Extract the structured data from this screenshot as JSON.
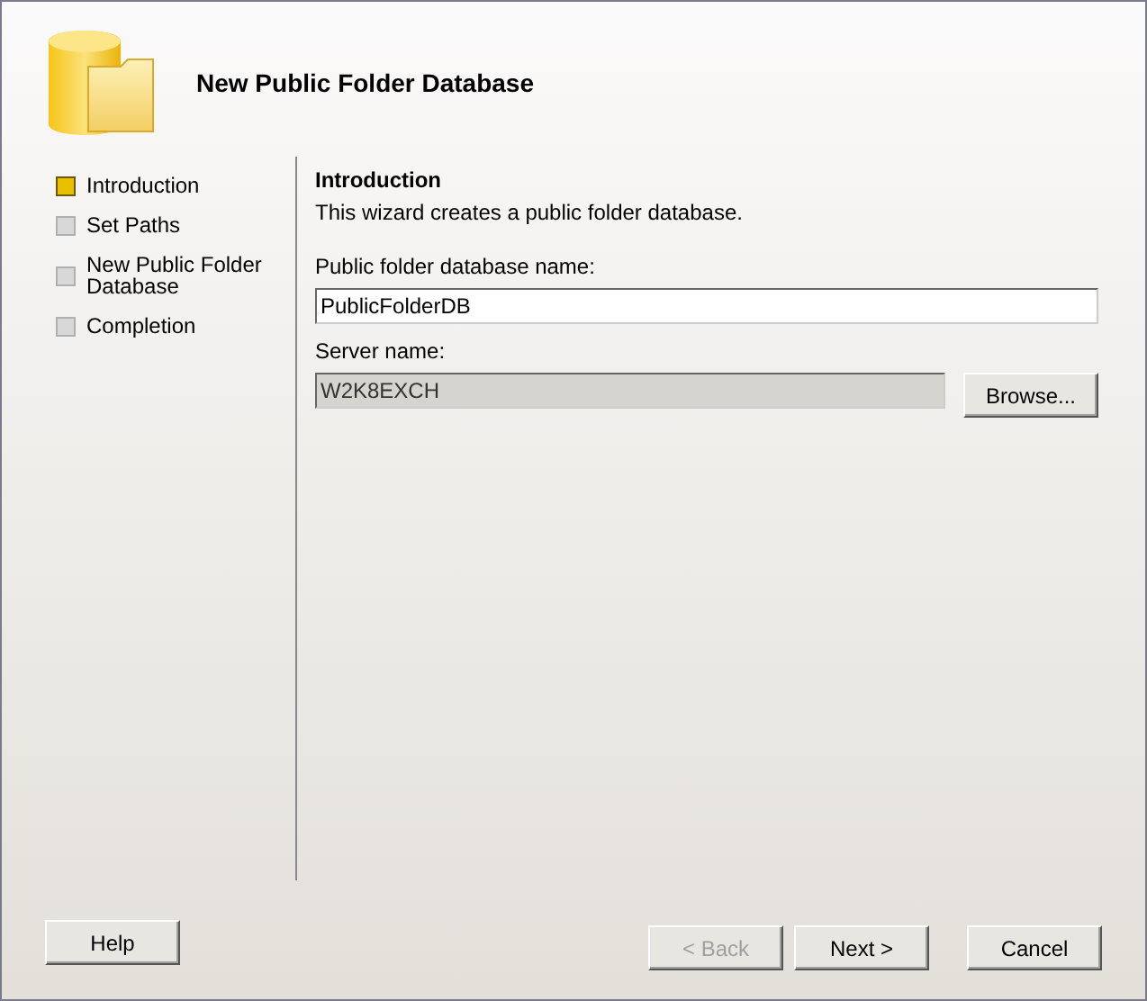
{
  "header": {
    "title": "New Public Folder Database"
  },
  "steps": [
    {
      "label": "Introduction",
      "selected": true
    },
    {
      "label": "Set Paths",
      "selected": false
    },
    {
      "label": "New Public Folder Database",
      "selected": false
    },
    {
      "label": "Completion",
      "selected": false
    }
  ],
  "page": {
    "heading": "Introduction",
    "description": "This wizard creates a public folder database.",
    "fields": [
      {
        "label": "Public folder database name:",
        "value": "PublicFolderDB",
        "disabled": false
      },
      {
        "label": "Server name:",
        "value": "W2K8EXCH",
        "disabled": true,
        "button": "Browse..."
      }
    ]
  },
  "buttons": {
    "help": "Help",
    "back": {
      "label": "< Back",
      "disabled": true
    },
    "next": {
      "label": "Next >",
      "disabled": false
    },
    "cancel": {
      "label": "Cancel",
      "disabled": false
    }
  }
}
